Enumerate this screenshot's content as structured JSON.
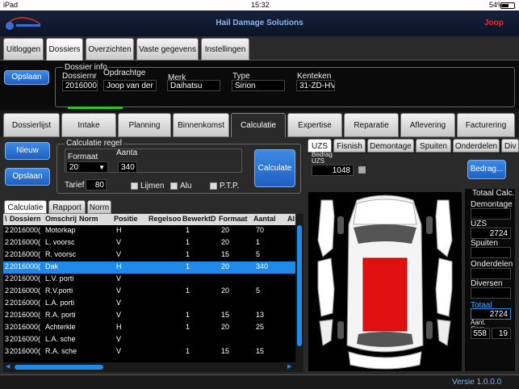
{
  "status": {
    "device": "iPad",
    "time": "15:32",
    "battery": "54%"
  },
  "app": {
    "title": "Hail Damage Solutions",
    "user": "Joop",
    "version": "Versie 1.0.0.0"
  },
  "main_tabs": [
    "Uitloggen",
    "Dossiers",
    "Overzichten",
    "Vaste gegevens",
    "Instellingen"
  ],
  "dossier": {
    "save_label": "Opslaan",
    "group_label": "Dossier info",
    "dossiernr_label": "Dossiernr",
    "dossiernr": "2016000",
    "opdrachtgever_label": "Opdrachtge",
    "opdrachtgever": "Joop van der S",
    "merk_label": "Merk",
    "merk": "Daihatsu",
    "type_label": "Type",
    "type": "Sirion",
    "kenteken_label": "Kenteken",
    "kenteken": "31-ZD-HV"
  },
  "process_tabs": [
    "Dossierlijst",
    "Intake",
    "Planning",
    "Binnenkomst",
    "Calculatie",
    "Expertise",
    "Reparatie",
    "Aflevering",
    "Facturering"
  ],
  "calc": {
    "new_label": "Nieuw",
    "save_label": "Opslaan",
    "regel_group": "Calculatie regel",
    "formaat_label": "Formaat",
    "formaat": "20",
    "aantal_label": "Aanta",
    "aantal": "340",
    "tarief_label": "Tarief",
    "tarief": "80",
    "calc_button": "Calculate",
    "checks": [
      "Lijmen",
      "Alu",
      "P.T.P."
    ]
  },
  "grid_tabs": [
    "Calculatie",
    "Rapport",
    "Norm"
  ],
  "grid": {
    "headers": [
      "\\",
      "Dossiern",
      "Omschrij",
      "Norm",
      "Positie",
      "Regelsoo",
      "BewerktD",
      "Formaat",
      "Aantal",
      "Al"
    ],
    "rows": [
      {
        "c0": "2",
        "nr": "2016000(",
        "oms": "Motorkap",
        "pos": "H",
        "bew": "1",
        "fmt": "20",
        "aant": "70"
      },
      {
        "c0": "2",
        "nr": "2016000(",
        "oms": "L. voorsc",
        "pos": "V",
        "bew": "1",
        "fmt": "20",
        "aant": "1"
      },
      {
        "c0": "2",
        "nr": "2016000(",
        "oms": "R. voorsc",
        "pos": "V",
        "bew": "1",
        "fmt": "15",
        "aant": "5"
      },
      {
        "c0": "2",
        "nr": "2016000(",
        "oms": "Dak",
        "pos": "H",
        "bew": "1",
        "fmt": "20",
        "aant": "340"
      },
      {
        "c0": "2",
        "nr": "2016000(",
        "oms": "L.V. porti",
        "pos": "V",
        "bew": "",
        "fmt": "",
        "aant": ""
      },
      {
        "c0": "2",
        "nr": "2016000(",
        "oms": "R.V.porti",
        "pos": "V",
        "bew": "1",
        "fmt": "20",
        "aant": "5"
      },
      {
        "c0": "2",
        "nr": "2016000(",
        "oms": "L.A. porti",
        "pos": "V",
        "bew": "",
        "fmt": "",
        "aant": ""
      },
      {
        "c0": "2",
        "nr": "2016000(",
        "oms": "R.A. porti",
        "pos": "V",
        "bew": "1",
        "fmt": "15",
        "aant": "13"
      },
      {
        "c0": "3",
        "nr": "2016000(",
        "oms": "Achterkle",
        "pos": "H",
        "bew": "1",
        "fmt": "20",
        "aant": "25"
      },
      {
        "c0": "3",
        "nr": "2016000(",
        "oms": "L.A. sche",
        "pos": "V",
        "bew": "",
        "fmt": "",
        "aant": ""
      },
      {
        "c0": "3",
        "nr": "2016000(",
        "oms": "R.A. sche",
        "pos": "V",
        "bew": "1",
        "fmt": "15",
        "aant": "15"
      }
    ]
  },
  "right_tabs": [
    "UZS",
    "Fisnish",
    "Demontage",
    "Spuiten",
    "Onderdelen",
    "Div"
  ],
  "uzs": {
    "bedrag_label": "Bedrag UZS",
    "bedrag": "1048",
    "button": "Bedrag..."
  },
  "totals": {
    "title": "Totaal Calc.",
    "demontage_label": "Demontage",
    "demontage": "",
    "uzs_label": "UZS",
    "uzs": "2724",
    "spuiten_label": "Spuiten",
    "spuiten": "",
    "onderdelen_label": "Onderdelen",
    "onderdelen": "",
    "diversen_label": "Diversen",
    "diversen": "",
    "totaal_label": "Totaal",
    "totaal": "2724",
    "aant_label": "Aant. Gem.",
    "aant1": "558",
    "aant2": "19"
  },
  "colors": {
    "accent": "#1f8ae8",
    "damage": "#e01010",
    "title": "#8fb3e8"
  }
}
